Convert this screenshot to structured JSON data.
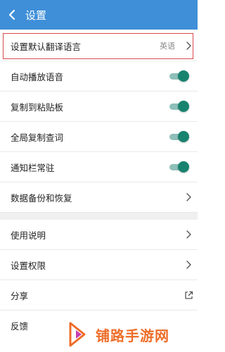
{
  "header": {
    "title": "设置",
    "back_icon": "chevron-left-icon",
    "background": "#3f8fd8"
  },
  "settings": {
    "default_language": {
      "label": "设置默认翻译语言",
      "value": "英语"
    },
    "auto_play": {
      "label": "自动播放语音",
      "checked": true
    },
    "copy_clipboard": {
      "label": "复制到粘贴板",
      "checked": true
    },
    "global_copy": {
      "label": "全局复制查词",
      "checked": true
    },
    "notify_bar": {
      "label": "通知栏常驻",
      "checked": true
    },
    "backup": {
      "label": "数据备份和恢复"
    },
    "usage": {
      "label": "使用说明"
    },
    "permissions": {
      "label": "设置权限"
    },
    "share": {
      "label": "分享",
      "icon": "external-link-icon"
    },
    "feedback": {
      "label": "反馈"
    }
  },
  "colors": {
    "toggle_on": "#17836f",
    "toggle_track": "#8ebfb8",
    "highlight_border": "#d84a4a"
  },
  "watermark": {
    "text": "铺路手游网",
    "color": "#ee6d28"
  }
}
